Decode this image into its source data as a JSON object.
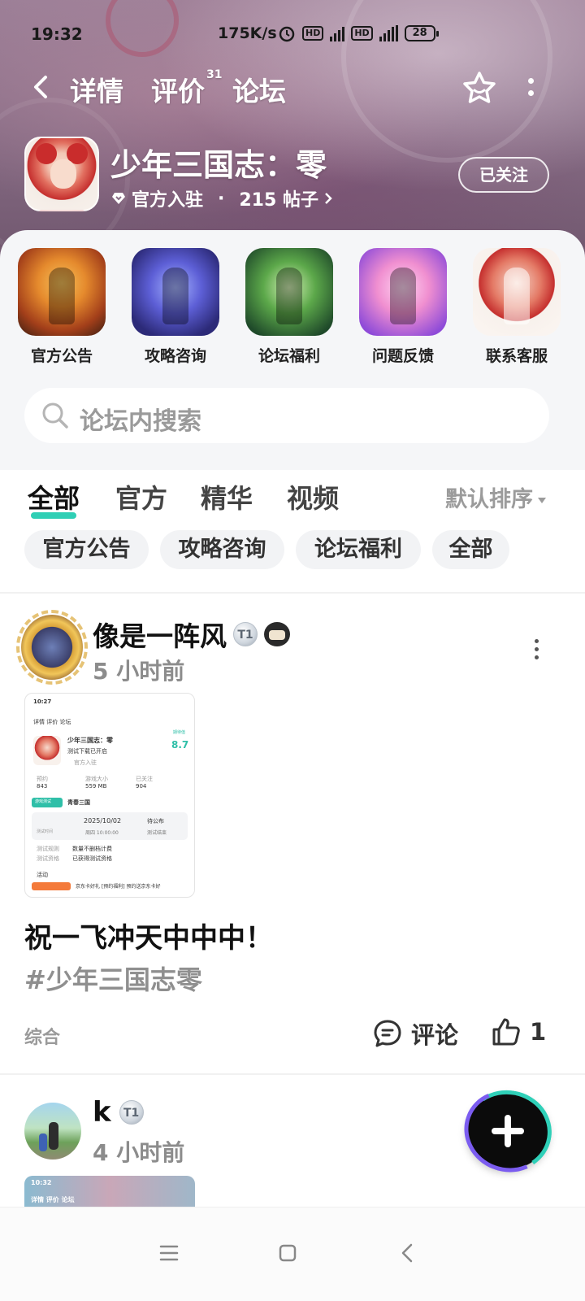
{
  "status_bar": {
    "time": "19:32",
    "net_speed": "175K/s",
    "hd1": "HD",
    "hd2": "HD",
    "net1": "4G",
    "net2": "4G",
    "battery": "28"
  },
  "nav": {
    "tabs": [
      {
        "label": "详情"
      },
      {
        "label": "评价",
        "count": "31"
      },
      {
        "label": "论坛",
        "active": true
      }
    ]
  },
  "game": {
    "title": "少年三国志：零",
    "official": "官方入驻",
    "separator": "·",
    "posts": "215 帖子",
    "follow_label": "已关注"
  },
  "shortcuts": [
    {
      "label": "官方公告"
    },
    {
      "label": "攻略咨询"
    },
    {
      "label": "论坛福利"
    },
    {
      "label": "问题反馈"
    },
    {
      "label": "联系客服"
    }
  ],
  "search": {
    "placeholder": "论坛内搜索"
  },
  "filter_tabs": [
    {
      "label": "全部",
      "active": true
    },
    {
      "label": "官方"
    },
    {
      "label": "精华"
    },
    {
      "label": "视频"
    }
  ],
  "sort": {
    "label": "默认排序"
  },
  "chips": [
    {
      "label": "官方公告"
    },
    {
      "label": "攻略咨询"
    },
    {
      "label": "论坛福利"
    },
    {
      "label": "全部"
    }
  ],
  "posts": [
    {
      "author": "像是一阵风",
      "level": "T1",
      "time": "5 小时前",
      "title": "祝一飞冲天中中中！",
      "tag": "#少年三国志零",
      "category": "综合",
      "comment_label": "评论",
      "likes": "1",
      "screenshot": {
        "time": "10:27",
        "tabs": "详情  评价  论坛",
        "game": "少年三国志：零",
        "sub": "测试下载已开启",
        "official": "官方入驻",
        "score_label": "期待值",
        "score": "8.7",
        "stat1_label": "预约",
        "stat1": "843",
        "stat2_label": "游戏大小",
        "stat2": "559 MB",
        "stat3_label": "已关注",
        "stat3": "904",
        "teal_tag": "游戏测试",
        "tag2": "青春三国",
        "date": "2025/10/02",
        "time2": "周四 10:00:00",
        "to": "待公布",
        "to_sub": "测试结束",
        "row_label1": "测试时间",
        "row_a_label": "测试规则",
        "row_a": "数量不删档计费",
        "row_b_label": "测试资格",
        "row_b": "已获得测试资格",
        "activity": "活动",
        "promo": "京东卡好礼 [预约福利] 预约送京东卡好"
      }
    },
    {
      "author": "k",
      "level": "T1",
      "time": "4 小时前",
      "screenshot": {
        "time": "10:32",
        "tabs": "详情  评价  论坛"
      }
    }
  ],
  "colors": {
    "accent": "#2fcfb5",
    "fab_ring_a": "#2fd0b8",
    "fab_ring_b": "#7b5cf0"
  }
}
